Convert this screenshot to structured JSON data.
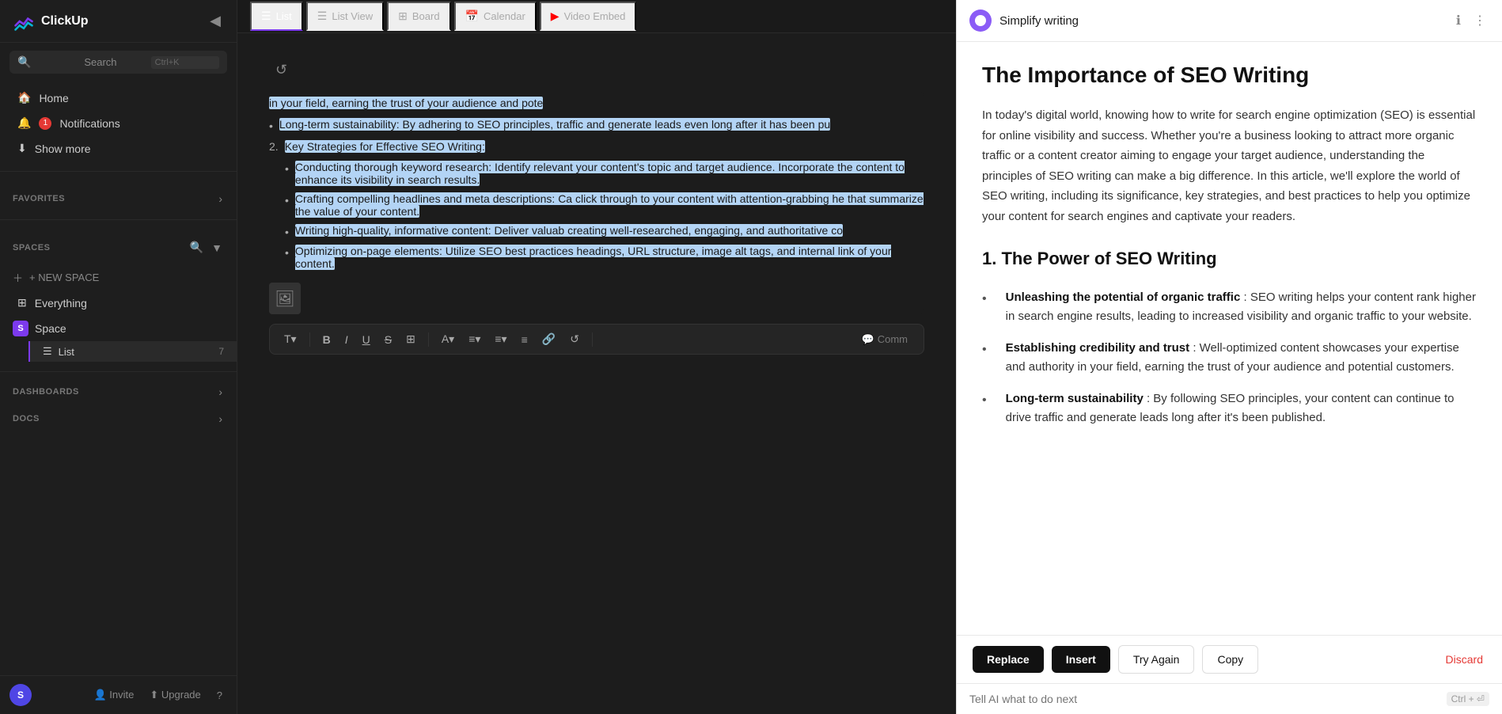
{
  "app": {
    "name": "ClickUp"
  },
  "sidebar": {
    "search_placeholder": "Search",
    "search_shortcut": "Ctrl+K",
    "collapse_btn": "◀",
    "nav": {
      "home_label": "Home",
      "notifications_label": "Notifications",
      "notifications_badge": "1",
      "show_more_label": "Show more"
    },
    "favorites": {
      "title": "FAVORITES",
      "chevron": "›"
    },
    "spaces": {
      "title": "SPACES",
      "new_space_label": "+ NEW SPACE",
      "everything_label": "Everything",
      "space_label": "Space",
      "space_initial": "S",
      "list_label": "List",
      "list_count": "7"
    },
    "dashboards": {
      "title": "DASHBOARDS",
      "chevron": "›"
    },
    "docs": {
      "title": "DOCS",
      "chevron": "›"
    },
    "bottom": {
      "invite_label": "Invite",
      "upgrade_label": "Upgrade",
      "help_label": "?"
    }
  },
  "main": {
    "tabs": [
      {
        "icon": "☰",
        "label": "List",
        "active": true
      },
      {
        "icon": "☰",
        "label": "List View",
        "active": false
      },
      {
        "icon": "⊞",
        "label": "Board",
        "active": false
      },
      {
        "icon": "📅",
        "label": "Calendar",
        "active": false
      },
      {
        "icon": "▶",
        "label": "Video Embed",
        "active": false
      }
    ],
    "editor": {
      "content_lines": [
        "in your field, earning the trust of your audience and pote...",
        "Long-term sustainability: By adhering to SEO principles, traffic and generate leads even long after it has been pu...",
        "Key Strategies for Effective SEO Writing:",
        "Conducting thorough keyword research: Identify relevant your content's topic and target audience. Incorporate the content to enhance its visibility in search results.",
        "Crafting compelling headlines and meta descriptions: Ca click through to your content with attention-grabbing he that summarize the value of your content.",
        "Writing high-quality, informative content: Deliver valuab creating well-researched, engaging, and authoritative co...",
        "Optimizing on-page elements: Utilize SEO best practices headings, URL structure, image alt tags, and internal link of your content."
      ],
      "toolbar_items": [
        "T",
        "B",
        "I",
        "U",
        "S",
        "⊞",
        "A",
        "≡",
        "≡",
        "≡",
        "🔗",
        "↺",
        "💬 Comm"
      ]
    }
  },
  "ai_panel": {
    "title": "Simplify writing",
    "main_title": "The Importance of SEO Writing",
    "intro": "In today's digital world, knowing how to write for search engine optimization (SEO) is essential for online visibility and success. Whether you're a business looking to attract more organic traffic or a content creator aiming to engage your target audience, understanding the principles of SEO writing can make a big difference. In this article, we'll explore the world of SEO writing, including its significance, key strategies, and best practices to help you optimize your content for search engines and captivate your readers.",
    "section1_title": "1. The Power of SEO Writing",
    "bullets": [
      {
        "bold": "Unleashing the potential of organic traffic",
        "text": ": SEO writing helps your content rank higher in search engine results, leading to increased visibility and organic traffic to your website."
      },
      {
        "bold": "Establishing credibility and trust",
        "text": ": Well-optimized content showcases your expertise and authority in your field, earning the trust of your audience and potential customers."
      },
      {
        "bold": "Long-term sustainability",
        "text": ": By following SEO principles, your content can continue to drive traffic and generate leads long after it's been published."
      }
    ],
    "actions": {
      "replace_label": "Replace",
      "insert_label": "Insert",
      "try_again_label": "Try Again",
      "copy_label": "Copy",
      "discard_label": "Discard"
    },
    "input_placeholder": "Tell AI what to do next",
    "input_shortcut": "Ctrl + ⏎"
  }
}
